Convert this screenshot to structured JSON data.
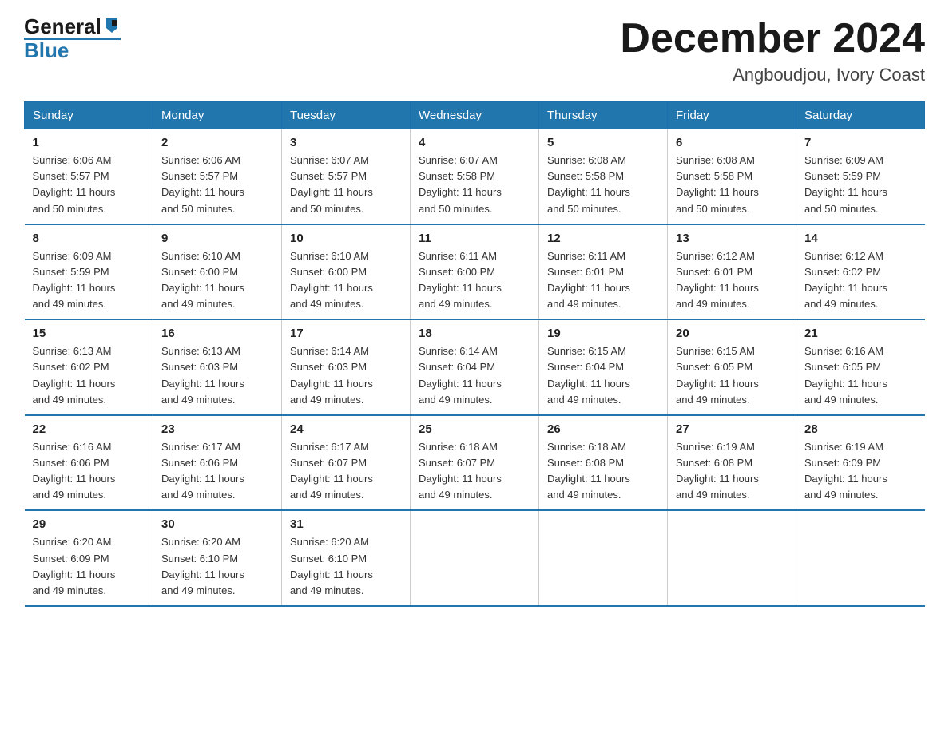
{
  "header": {
    "logo_general": "General",
    "logo_blue": "Blue",
    "month_title": "December 2024",
    "location": "Angboudjou, Ivory Coast"
  },
  "days_of_week": [
    "Sunday",
    "Monday",
    "Tuesday",
    "Wednesday",
    "Thursday",
    "Friday",
    "Saturday"
  ],
  "weeks": [
    [
      {
        "day": "1",
        "sunrise": "6:06 AM",
        "sunset": "5:57 PM",
        "daylight": "11 hours and 50 minutes."
      },
      {
        "day": "2",
        "sunrise": "6:06 AM",
        "sunset": "5:57 PM",
        "daylight": "11 hours and 50 minutes."
      },
      {
        "day": "3",
        "sunrise": "6:07 AM",
        "sunset": "5:57 PM",
        "daylight": "11 hours and 50 minutes."
      },
      {
        "day": "4",
        "sunrise": "6:07 AM",
        "sunset": "5:58 PM",
        "daylight": "11 hours and 50 minutes."
      },
      {
        "day": "5",
        "sunrise": "6:08 AM",
        "sunset": "5:58 PM",
        "daylight": "11 hours and 50 minutes."
      },
      {
        "day": "6",
        "sunrise": "6:08 AM",
        "sunset": "5:58 PM",
        "daylight": "11 hours and 50 minutes."
      },
      {
        "day": "7",
        "sunrise": "6:09 AM",
        "sunset": "5:59 PM",
        "daylight": "11 hours and 50 minutes."
      }
    ],
    [
      {
        "day": "8",
        "sunrise": "6:09 AM",
        "sunset": "5:59 PM",
        "daylight": "11 hours and 49 minutes."
      },
      {
        "day": "9",
        "sunrise": "6:10 AM",
        "sunset": "6:00 PM",
        "daylight": "11 hours and 49 minutes."
      },
      {
        "day": "10",
        "sunrise": "6:10 AM",
        "sunset": "6:00 PM",
        "daylight": "11 hours and 49 minutes."
      },
      {
        "day": "11",
        "sunrise": "6:11 AM",
        "sunset": "6:00 PM",
        "daylight": "11 hours and 49 minutes."
      },
      {
        "day": "12",
        "sunrise": "6:11 AM",
        "sunset": "6:01 PM",
        "daylight": "11 hours and 49 minutes."
      },
      {
        "day": "13",
        "sunrise": "6:12 AM",
        "sunset": "6:01 PM",
        "daylight": "11 hours and 49 minutes."
      },
      {
        "day": "14",
        "sunrise": "6:12 AM",
        "sunset": "6:02 PM",
        "daylight": "11 hours and 49 minutes."
      }
    ],
    [
      {
        "day": "15",
        "sunrise": "6:13 AM",
        "sunset": "6:02 PM",
        "daylight": "11 hours and 49 minutes."
      },
      {
        "day": "16",
        "sunrise": "6:13 AM",
        "sunset": "6:03 PM",
        "daylight": "11 hours and 49 minutes."
      },
      {
        "day": "17",
        "sunrise": "6:14 AM",
        "sunset": "6:03 PM",
        "daylight": "11 hours and 49 minutes."
      },
      {
        "day": "18",
        "sunrise": "6:14 AM",
        "sunset": "6:04 PM",
        "daylight": "11 hours and 49 minutes."
      },
      {
        "day": "19",
        "sunrise": "6:15 AM",
        "sunset": "6:04 PM",
        "daylight": "11 hours and 49 minutes."
      },
      {
        "day": "20",
        "sunrise": "6:15 AM",
        "sunset": "6:05 PM",
        "daylight": "11 hours and 49 minutes."
      },
      {
        "day": "21",
        "sunrise": "6:16 AM",
        "sunset": "6:05 PM",
        "daylight": "11 hours and 49 minutes."
      }
    ],
    [
      {
        "day": "22",
        "sunrise": "6:16 AM",
        "sunset": "6:06 PM",
        "daylight": "11 hours and 49 minutes."
      },
      {
        "day": "23",
        "sunrise": "6:17 AM",
        "sunset": "6:06 PM",
        "daylight": "11 hours and 49 minutes."
      },
      {
        "day": "24",
        "sunrise": "6:17 AM",
        "sunset": "6:07 PM",
        "daylight": "11 hours and 49 minutes."
      },
      {
        "day": "25",
        "sunrise": "6:18 AM",
        "sunset": "6:07 PM",
        "daylight": "11 hours and 49 minutes."
      },
      {
        "day": "26",
        "sunrise": "6:18 AM",
        "sunset": "6:08 PM",
        "daylight": "11 hours and 49 minutes."
      },
      {
        "day": "27",
        "sunrise": "6:19 AM",
        "sunset": "6:08 PM",
        "daylight": "11 hours and 49 minutes."
      },
      {
        "day": "28",
        "sunrise": "6:19 AM",
        "sunset": "6:09 PM",
        "daylight": "11 hours and 49 minutes."
      }
    ],
    [
      {
        "day": "29",
        "sunrise": "6:20 AM",
        "sunset": "6:09 PM",
        "daylight": "11 hours and 49 minutes."
      },
      {
        "day": "30",
        "sunrise": "6:20 AM",
        "sunset": "6:10 PM",
        "daylight": "11 hours and 49 minutes."
      },
      {
        "day": "31",
        "sunrise": "6:20 AM",
        "sunset": "6:10 PM",
        "daylight": "11 hours and 49 minutes."
      },
      null,
      null,
      null,
      null
    ]
  ],
  "labels": {
    "sunrise_prefix": "Sunrise: ",
    "sunset_prefix": "Sunset: ",
    "daylight_prefix": "Daylight: "
  }
}
